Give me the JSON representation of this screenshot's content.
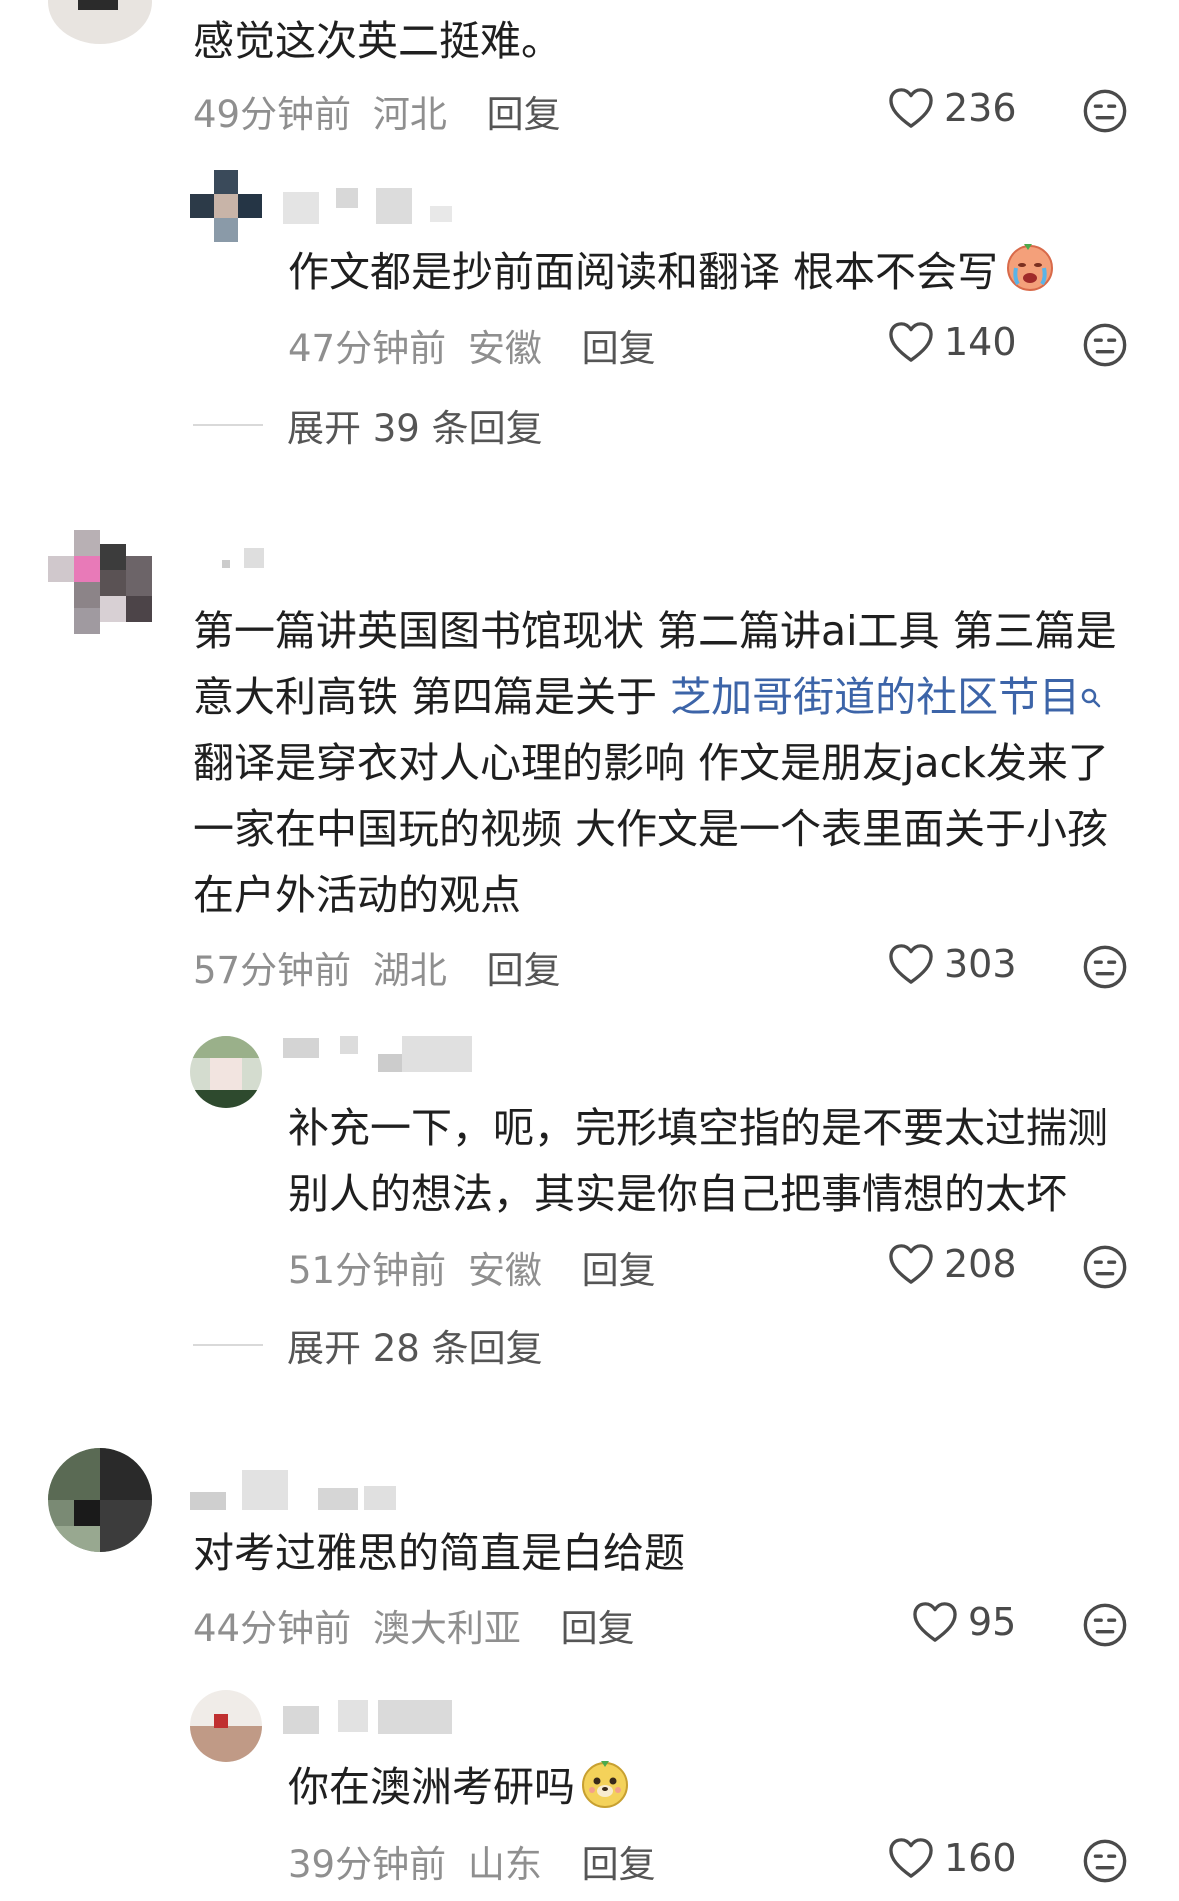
{
  "comments": [
    {
      "text": "感觉这次英二挺难。",
      "time": "49分钟前",
      "location": "河北",
      "reply_label": "回复",
      "likes": "236",
      "replies": [
        {
          "text": "作文都是抄前面阅读和翻译 根本不会写",
          "emoji_icon": "crying-emoji-icon",
          "time": "47分钟前",
          "location": "安徽",
          "reply_label": "回复",
          "likes": "140"
        }
      ],
      "expand_label": "展开 39 条回复"
    },
    {
      "text_lines": [
        "第一篇讲英国图书馆现状 第二篇讲ai工具 第三篇是",
        "意大利高铁 第四篇是关于 ",
        "翻译是穿衣对人心理的影响 作文是朋友jack发来了",
        "一家在中国玩的视频 大作文是一个表里面关于小孩",
        "在户外活动的观点"
      ],
      "link_text": "芝加哥街道的社区节目",
      "link_icon": "search-icon",
      "time": "57分钟前",
      "location": "湖北",
      "reply_label": "回复",
      "likes": "303",
      "replies": [
        {
          "text_lines": [
            "补充一下，呃，完形填空指的是不要太过揣测",
            "别人的想法，其实是你自己把事情想的太坏"
          ],
          "time": "51分钟前",
          "location": "安徽",
          "reply_label": "回复",
          "likes": "208"
        }
      ],
      "expand_label": "展开 28 条回复"
    },
    {
      "text": "对考过雅思的简直是白给题",
      "time": "44分钟前",
      "location": "澳大利亚",
      "reply_label": "回复",
      "likes": "95",
      "replies": [
        {
          "text": "你在澳洲考研吗",
          "emoji_icon": "bear-emoji-icon",
          "time": "39分钟前",
          "location": "山东",
          "reply_label": "回复",
          "likes": "160"
        }
      ]
    }
  ],
  "colors": {
    "text": "#1f1f1f",
    "meta": "#8f8f8f",
    "link": "#3c64a8",
    "icon": "#4a4a4a"
  }
}
